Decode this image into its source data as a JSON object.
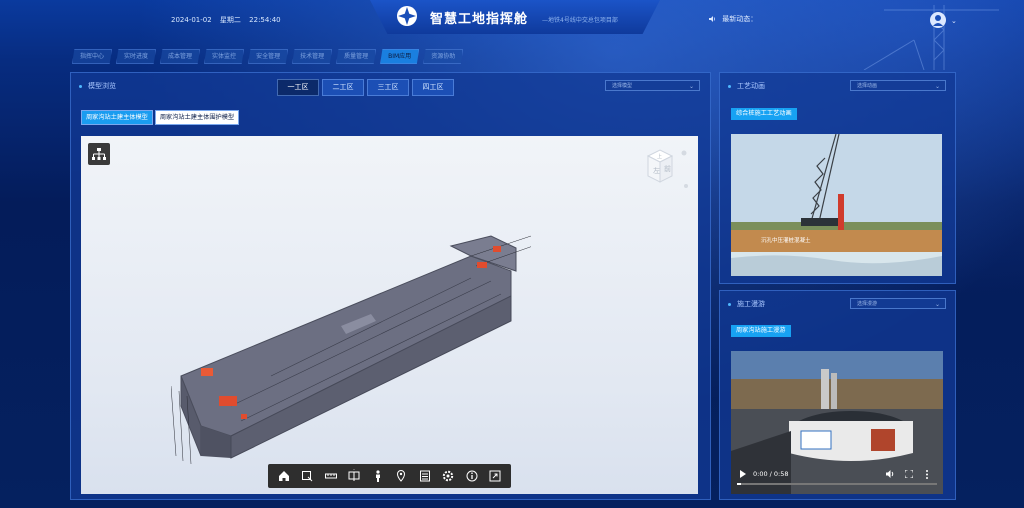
{
  "header": {
    "date": "2024-01-02",
    "weekday": "星期二",
    "time": "22:54:40",
    "title": "智慧工地指挥舱",
    "subtitle": "—地铁4号线中交总包项目部",
    "news_label": "最新动态："
  },
  "nav": {
    "items": [
      "指挥中心",
      "实时进度",
      "成本管理",
      "实体监控",
      "安全管理",
      "技术管理",
      "质量管理",
      "BIM应用",
      "资源协助"
    ],
    "active_index": 7
  },
  "model_panel": {
    "title": "模型浏览",
    "tabs": [
      "一工区",
      "二工区",
      "三工区",
      "四工区"
    ],
    "active_tab": 0,
    "select": {
      "value": "选择模型"
    },
    "model_buttons": [
      "周家沟站土建主体模型",
      "周家沟站土建主体围护模型"
    ],
    "active_model": 0,
    "toolbar_icons": [
      "home-icon",
      "zoom-window-icon",
      "measure-icon",
      "section-icon",
      "person-icon",
      "locate-icon",
      "properties-icon",
      "settings-icon",
      "info-icon",
      "fullscreen-icon"
    ],
    "viewcube": {
      "left_label": "左",
      "front_label": "前",
      "top_label": "上"
    }
  },
  "process_panel": {
    "title": "工艺动画",
    "select": {
      "value": "选择动画"
    },
    "button": "综合桩施工工艺动画",
    "caption": "沉孔中压灌桩混凝土"
  },
  "construction_panel": {
    "title": "施工漫游",
    "select": {
      "value": "选择漫游"
    },
    "button": "周家沟站施工漫游",
    "video": {
      "time": "0:00 / 0:58",
      "progress": 0.02
    }
  },
  "colors": {
    "accent": "#17a2f3",
    "panel": "#123a96",
    "nav_active": "#1a7fe0"
  }
}
